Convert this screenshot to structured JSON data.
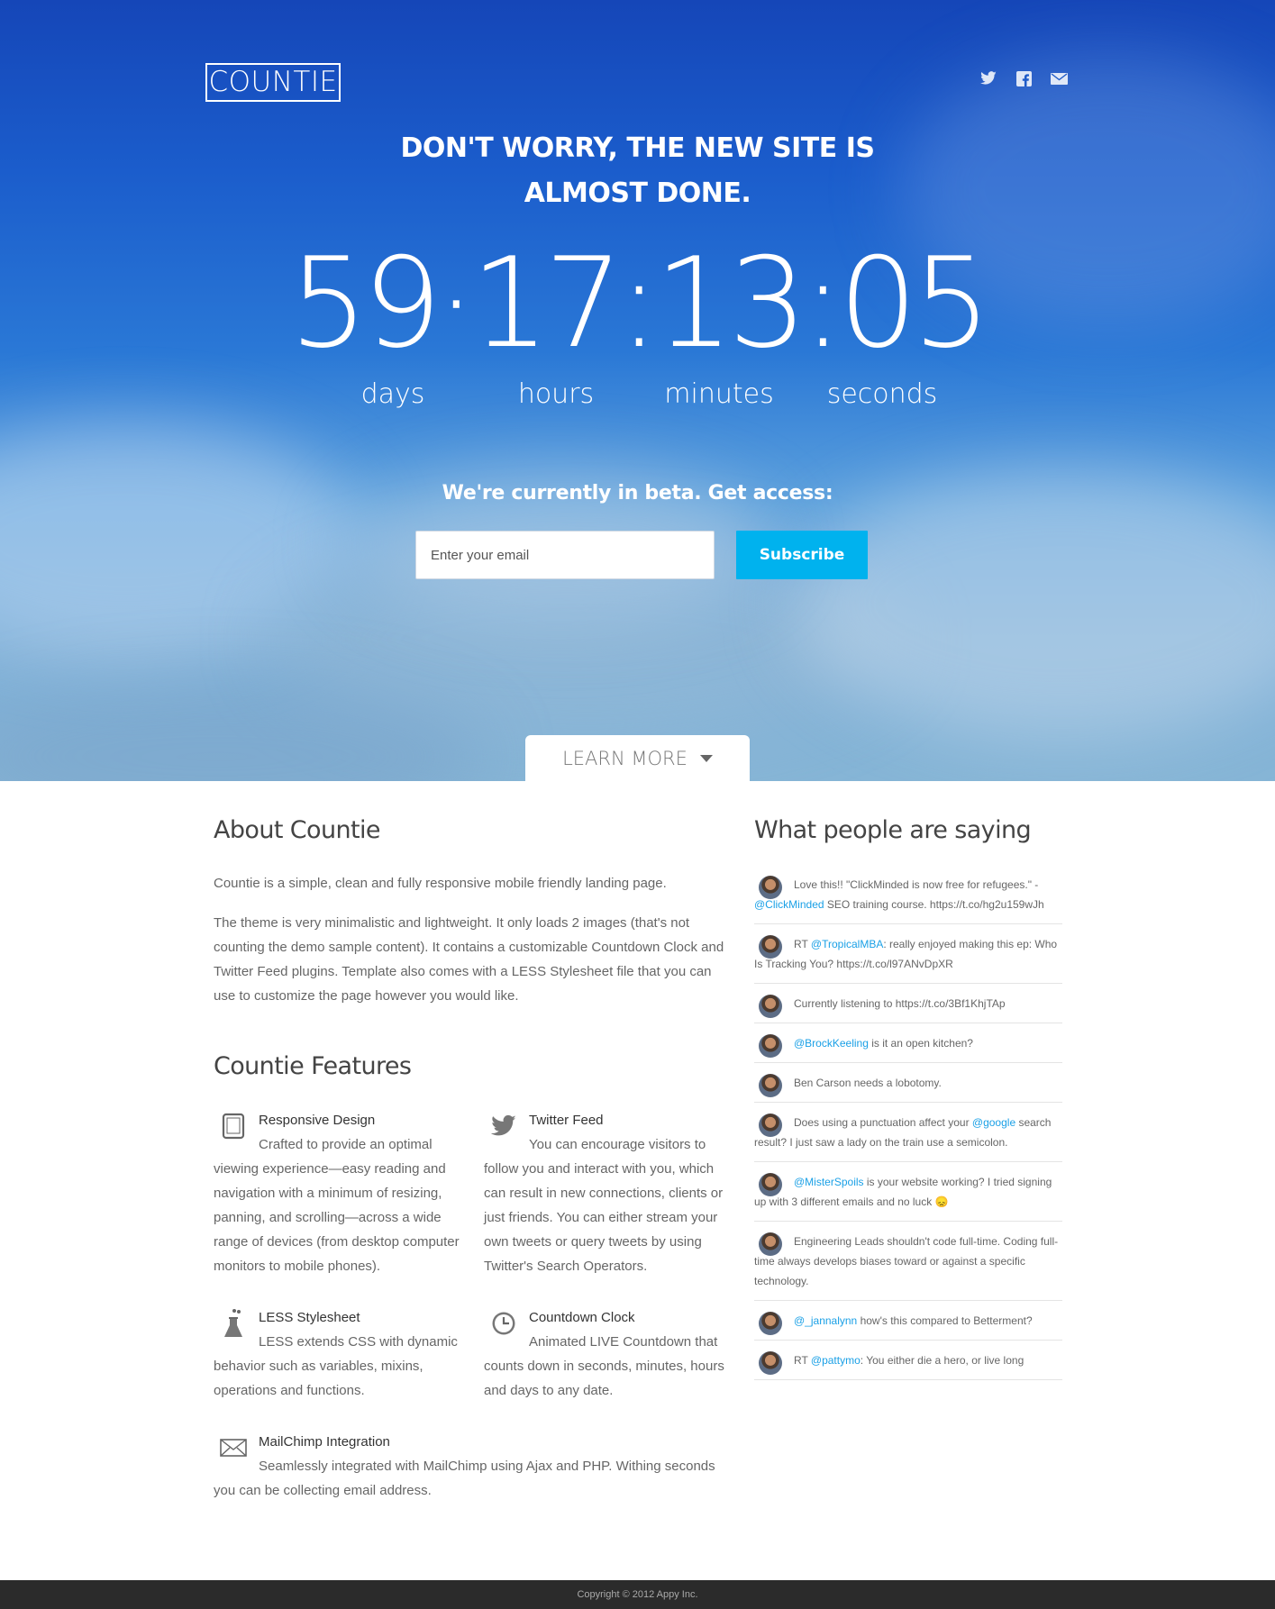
{
  "brand": {
    "logo_text": "COUNTIE"
  },
  "social": {
    "twitter_icon": "twitter-icon",
    "facebook_icon": "facebook-icon",
    "mail_icon": "mail-icon"
  },
  "hero": {
    "headline_line1": "DON'T WORRY, THE NEW SITE IS",
    "headline_line2": "ALMOST DONE.",
    "countdown": {
      "days": "59",
      "hours": "17",
      "minutes": "13",
      "seconds": "05",
      "days_label": "days",
      "hours_label": "hours",
      "minutes_label": "minutes",
      "seconds_label": "seconds"
    },
    "beta_text": "We're currently in beta. Get access:",
    "email_placeholder": "Enter your email",
    "subscribe_label": "Subscribe",
    "learn_more_label": "LEARN MORE"
  },
  "about": {
    "title": "About Countie",
    "p1": "Countie is a simple, clean and fully responsive mobile friendly landing page.",
    "p2": "The theme is very minimalistic and lightweight. It only loads 2 images (that's not counting the demo sample content). It contains a customizable Countdown Clock and Twitter Feed plugins. Template also comes with a LESS Stylesheet file that you can use to customize the page however you would like."
  },
  "features": {
    "title": "Countie Features",
    "items": [
      {
        "icon": "tablet-icon",
        "title": "Responsive Design",
        "desc": "Crafted to provide an optimal viewing experience—easy reading and navigation with a minimum of resizing, panning, and scrolling—across a wide range of devices (from desktop computer monitors to mobile phones)."
      },
      {
        "icon": "twitter-bird-icon",
        "title": "Twitter Feed",
        "desc": "You can encourage visitors to follow you and interact with you, which can result in new connections, clients or just friends. You can either stream your own tweets or query tweets by using Twitter's Search Operators."
      },
      {
        "icon": "flask-icon",
        "title": "LESS Stylesheet",
        "desc": "LESS extends CSS with dynamic behavior such as variables, mixins, operations and functions."
      },
      {
        "icon": "clock-icon",
        "title": "Countdown Clock",
        "desc": "Animated LIVE Countdown that counts down in seconds, minutes, hours and days to any date."
      },
      {
        "icon": "envelope-icon",
        "title": "MailChimp Integration",
        "desc": "Seamlessly integrated with MailChimp using Ajax and PHP. Withing seconds you can be collecting email address."
      }
    ]
  },
  "tweets": {
    "title": "What people are saying",
    "items": [
      {
        "pre": "Love this!! \"ClickMinded is now free for refugees.\" - ",
        "link": "@ClickMinded",
        "post": " SEO training course. https://t.co/hg2u159wJh"
      },
      {
        "pre": "RT ",
        "link": "@TropicalMBA",
        "post": ": really enjoyed making this ep: Who Is Tracking You? https://t.co/l97ANvDpXR"
      },
      {
        "pre": "Currently listening to https://t.co/3Bf1KhjTAp",
        "link": "",
        "post": ""
      },
      {
        "pre": "",
        "link": "@BrockKeeling",
        "post": " is it an open kitchen?"
      },
      {
        "pre": "Ben Carson needs a lobotomy.",
        "link": "",
        "post": ""
      },
      {
        "pre": "Does using a punctuation affect your ",
        "link": "@google",
        "post": " search result? I just saw a lady on the train use a semicolon."
      },
      {
        "pre": "",
        "link": "@MisterSpoils",
        "post": " is your website working? I tried signing up with 3 different emails and no luck 😞"
      },
      {
        "pre": "Engineering Leads shouldn't code full-time. Coding full-time always develops biases toward or against a specific technology.",
        "link": "",
        "post": ""
      },
      {
        "pre": "",
        "link": "@_jannalynn",
        "post": " how's this compared to Betterment?"
      },
      {
        "pre": "RT ",
        "link": "@pattymo",
        "post": ": You either die a hero, or live long"
      }
    ]
  },
  "footer": {
    "copyright": "Copyright © 2012 Appy Inc."
  },
  "colors": {
    "accent": "#00b2ee",
    "link": "#1aa0e6",
    "footer_bg": "#2b2b2b"
  }
}
